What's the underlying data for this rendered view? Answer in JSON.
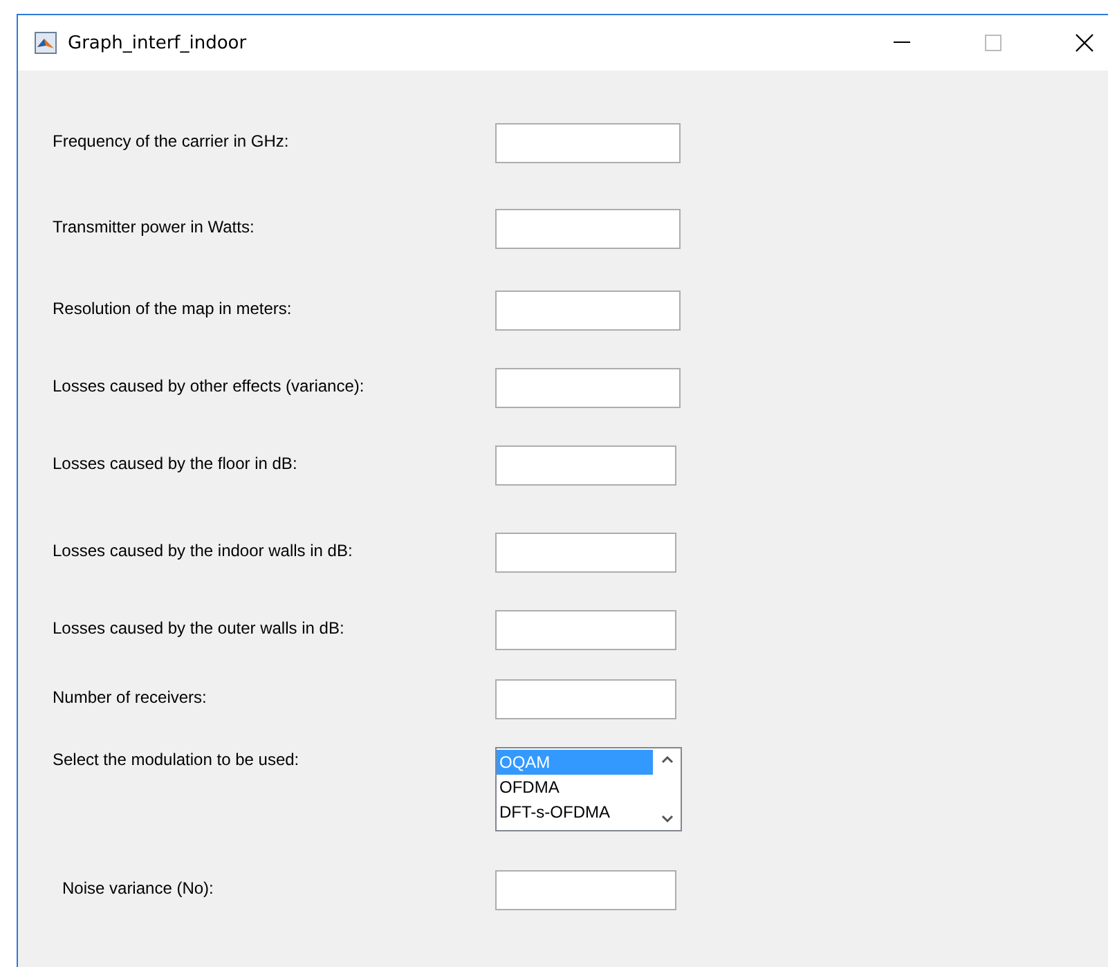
{
  "window": {
    "title": "Graph_interf_indoor"
  },
  "fields": [
    {
      "label": "Frequency of the carrier in GHz:",
      "kind": "input"
    },
    {
      "label": "Transmitter power in Watts:",
      "kind": "input"
    },
    {
      "label": "Resolution of the map in meters:",
      "kind": "input"
    },
    {
      "label": "Losses caused by other effects (variance):",
      "kind": "input"
    },
    {
      "label": "Losses caused by the floor in dB:",
      "kind": "input"
    },
    {
      "label": "Losses caused by the indoor walls in dB:",
      "kind": "input"
    },
    {
      "label": "Losses caused by the outer walls in dB:",
      "kind": "input"
    },
    {
      "label": "Number of receivers:",
      "kind": "input"
    },
    {
      "label": "Select the modulation to be used:",
      "kind": "list",
      "options": [
        {
          "text": "OQAM",
          "selected": true
        },
        {
          "text": "OFDMA",
          "selected": false
        },
        {
          "text": "DFT-s-OFDMA",
          "selected": false
        }
      ]
    },
    {
      "label": "Noise variance (No):",
      "kind": "input"
    }
  ]
}
